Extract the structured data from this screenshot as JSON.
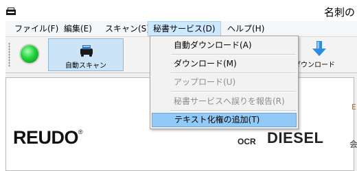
{
  "window": {
    "title": "名刺の"
  },
  "menubar": {
    "items": [
      {
        "label": "ファイル(F)"
      },
      {
        "label": "編集(E)"
      },
      {
        "label": "スキャン(S)"
      },
      {
        "label": "秘書サービス(D)"
      },
      {
        "label": "ヘルプ(H)"
      }
    ]
  },
  "toolbar": {
    "auto_scan_label": "自動スキャン",
    "download_label": "ダウンロード"
  },
  "dropdown": {
    "items": [
      {
        "label": "自動ダウンロード(A)",
        "enabled": true
      },
      {
        "label": "ダウンロード(M)",
        "enabled": true
      },
      {
        "label": "アップロード(U)",
        "enabled": false
      },
      {
        "label": "秘書サービスへ誤りを報告(R)",
        "enabled": false
      },
      {
        "label": "テキスト化権の追加(T)",
        "enabled": true,
        "highlighted": true
      }
    ]
  },
  "content": {
    "logo_left": "REUDO",
    "logo_left_mark": "®",
    "logo_right_prefix": "OCR",
    "logo_right": "DIESEL",
    "side_text": "会",
    "side_text_top": "E"
  },
  "colors": {
    "menu_highlight": "#91c9f7",
    "active_menu": "#cce8ff",
    "status_light": "#22d23c"
  }
}
